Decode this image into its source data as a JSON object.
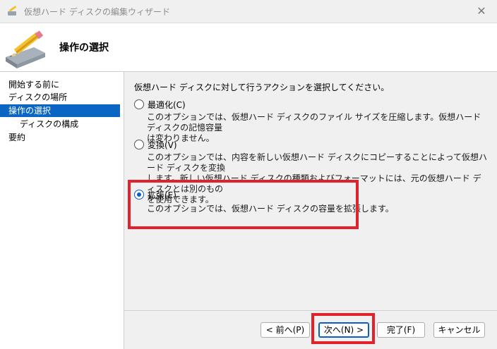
{
  "window": {
    "title": "仮想ハード ディスクの編集ウィザード",
    "close_symbol": "✕"
  },
  "header": {
    "title": "操作の選択",
    "icon": "disk-pencil-icon"
  },
  "sidebar": {
    "items": [
      {
        "label": "開始する前に"
      },
      {
        "label": "ディスクの場所"
      },
      {
        "label": "操作の選択"
      },
      {
        "label": "ディスクの構成"
      },
      {
        "label": "要約"
      }
    ]
  },
  "main": {
    "intro": "仮想ハード ディスクに対して行うアクションを選択してください。",
    "options": [
      {
        "label": "最適化(C)",
        "checked": false,
        "desc_lines": [
          "このオプションでは、仮想ハード ディスクのファイル サイズを圧縮します。仮想ハード ディスクの記憶容量",
          "は変わりません。"
        ]
      },
      {
        "label": "変換(V)",
        "checked": false,
        "desc_lines": [
          "このオプションでは、内容を新しい仮想ハード ディスクにコピーすることによって仮想ハード ディスクを変換",
          "します。新しい仮想ハード ディスクの種類およびフォーマットには、元の仮想ハード ディスクとは別のもの",
          "を使用できます。"
        ]
      },
      {
        "label": "拡張(E)",
        "checked": true,
        "desc_lines": [
          "このオプションでは、仮想ハード ディスクの容量を拡張します。"
        ]
      }
    ]
  },
  "buttons": {
    "back": "< 前へ(P)",
    "next": "次へ(N) >",
    "finish": "完了(F)",
    "cancel": "キャンセル"
  },
  "colors": {
    "selection": "#0a66c2",
    "highlight_box": "#e0222d"
  }
}
